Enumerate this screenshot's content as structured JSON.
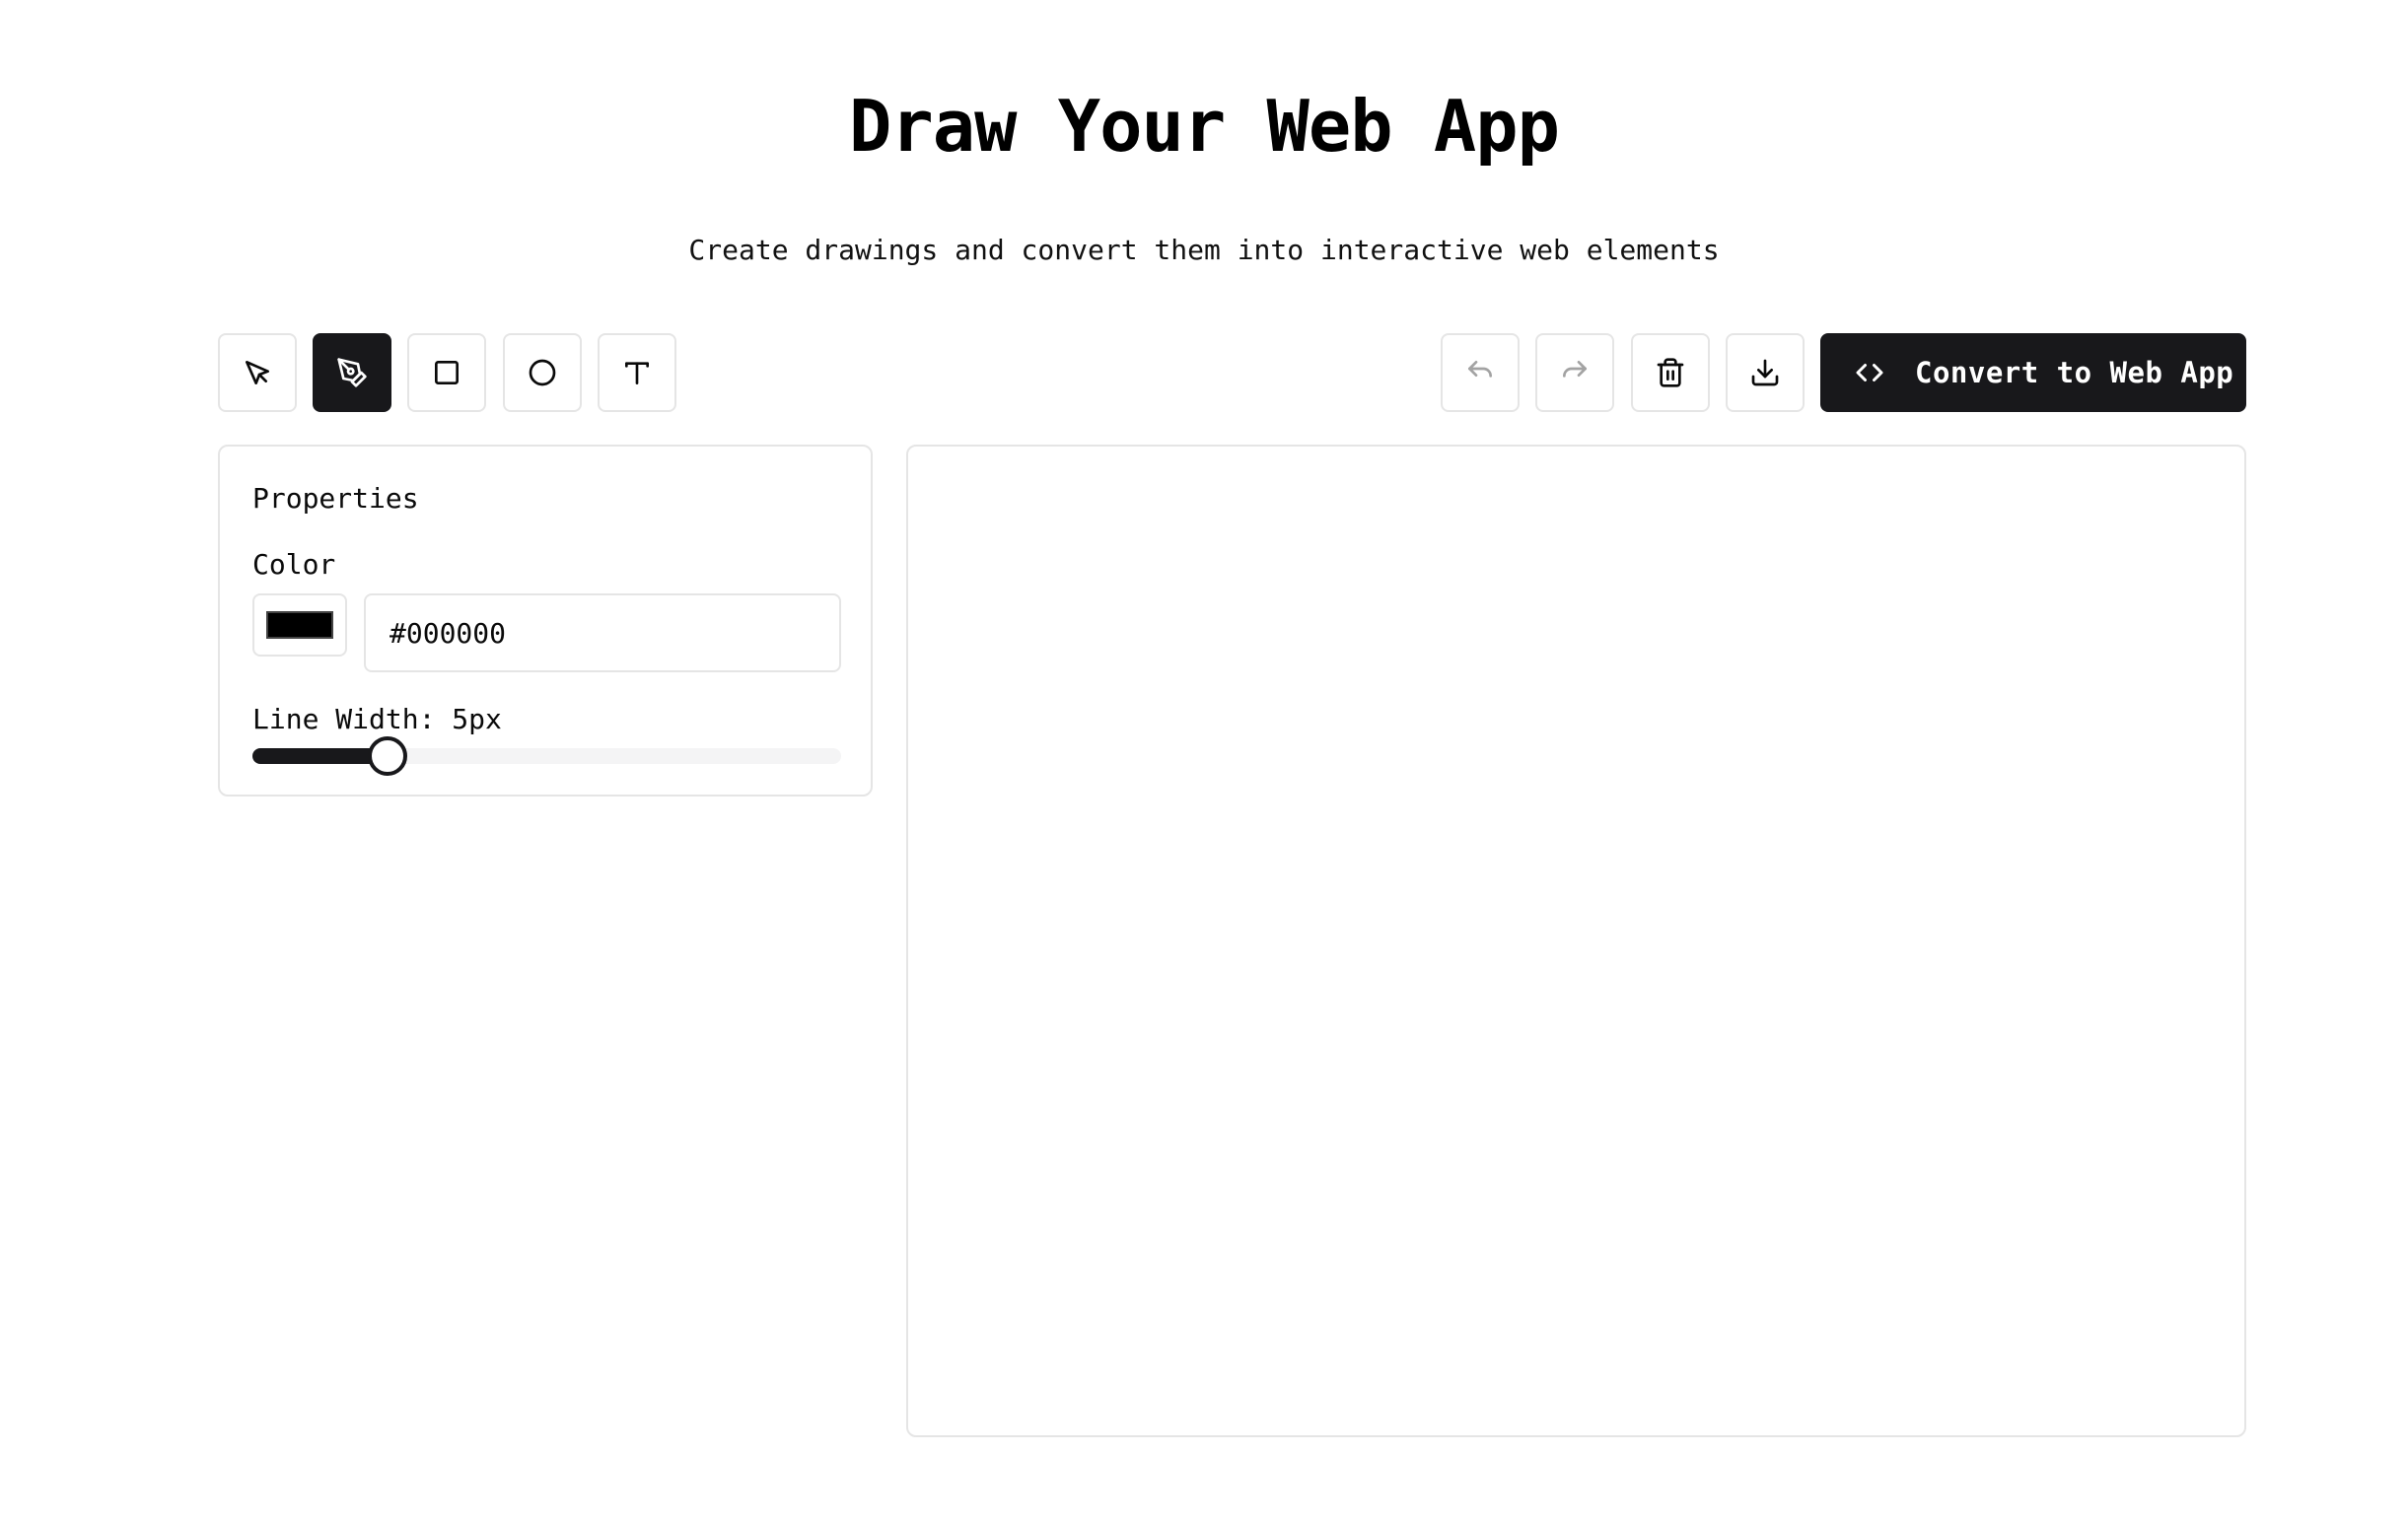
{
  "header": {
    "title": "Draw Your Web App",
    "subtitle": "Create drawings and convert them into interactive web elements"
  },
  "toolbar": {
    "tools": [
      {
        "name": "select",
        "icon": "pointer-icon",
        "active": false
      },
      {
        "name": "pen",
        "icon": "pen-tool-icon",
        "active": true
      },
      {
        "name": "rectangle",
        "icon": "square-icon",
        "active": false
      },
      {
        "name": "circle",
        "icon": "circle-icon",
        "active": false
      },
      {
        "name": "text",
        "icon": "text-icon",
        "active": false
      }
    ],
    "actions": [
      {
        "name": "undo",
        "icon": "undo-icon",
        "enabled": false
      },
      {
        "name": "redo",
        "icon": "redo-icon",
        "enabled": false
      },
      {
        "name": "clear",
        "icon": "trash-icon",
        "enabled": true
      },
      {
        "name": "download",
        "icon": "download-icon",
        "enabled": true
      }
    ],
    "convert_label": "Convert to Web App"
  },
  "properties": {
    "title": "Properties",
    "color_label": "Color",
    "color_value": "#000000",
    "line_width_label": "Line Width: 5px",
    "line_width_fraction": 0.23
  },
  "colors": {
    "accent": "#18181b",
    "border": "#e5e5e5",
    "background": "#ffffff"
  }
}
